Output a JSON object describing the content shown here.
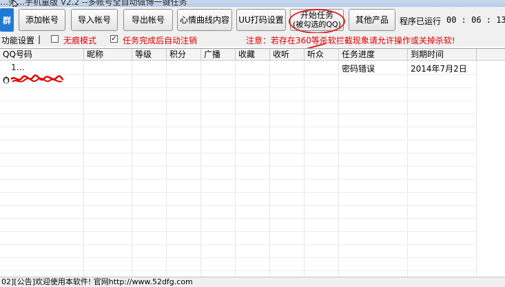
{
  "window": {
    "title": "…务…手机量版 V2.2 --多帐号全自动做博一键任务"
  },
  "toolbar": {
    "qun_label": "群",
    "add_account": "添加帐号",
    "import_account": "导入帐号",
    "export_account": "导出帐号",
    "mood_curve": "心情曲线内容",
    "uu_captcha": "UU打码设置",
    "start_task": "开始任务",
    "start_task_sub": "(被勾选的QQ)",
    "other_products": "其他产品",
    "runtime_label": "程序已运行",
    "runtime_value": "00 : 06 : 13"
  },
  "settings": {
    "label": "功能设置",
    "separator": "|",
    "incognito": {
      "label": "无痕模式",
      "checked": false
    },
    "auto_logout": {
      "label": "任务完成后自动注销",
      "checked": true
    },
    "notice": "注意：若存在360等杀软拦截现象请允许操作或关掉杀软!"
  },
  "grid": {
    "columns": [
      "QQ号码",
      "昵称",
      "等级",
      "积分",
      "广播",
      "收藏",
      "收听",
      "听众",
      "任务进度",
      "到期时间"
    ],
    "rows": [
      {
        "qq": "1…",
        "nickname": "",
        "level": "",
        "points": "",
        "broadcast": "",
        "favorites": "",
        "following": "",
        "followers": "",
        "progress": "密码错误",
        "expiry": "2014年7月2日"
      }
    ]
  },
  "statusbar": {
    "text": "02][公告]欢迎使用本软件! 官网http://www.52dfg.com"
  },
  "colors": {
    "accent_red": "#e00000",
    "qun_blue": "#1f7ad6",
    "annotation_red": "#e02020"
  }
}
